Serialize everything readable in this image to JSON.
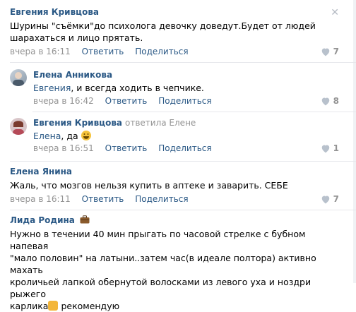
{
  "comments": [
    {
      "author": "Евгения Кривцова",
      "text_lines": [
        "Шурины \"съёмки\"до психолога девочку доведут.Будет от людей",
        "шарахаться и лицо прятать."
      ],
      "time": "вчера в 16:11",
      "reply": "Ответить",
      "share": "Поделиться",
      "likes": "7"
    },
    {
      "author": "Елена Анникова",
      "mention": "Евгения",
      "text": ", и всегда ходить в чепчике.",
      "time": "вчера в 16:42",
      "reply": "Ответить",
      "share": "Поделиться",
      "likes": "8"
    },
    {
      "author": "Евгения Кривцова",
      "replied_to": "ответила Елене",
      "mention": "Елена",
      "text": ", да",
      "emoji": "grinning-face",
      "time": "вчера в 16:51",
      "reply": "Ответить",
      "share": "Поделиться",
      "likes": "1"
    },
    {
      "author": "Елена Янина",
      "text": "Жаль, что мозгов нельзя купить в аптеке и заварить. СЕБЕ",
      "time": "вчера в 16:11",
      "reply": "Ответить",
      "share": "Поделиться",
      "likes": "7"
    },
    {
      "author": "Лида Родина",
      "badge": "briefcase-icon",
      "text_lines": [
        "Нужно в течении 40 мин прыгать по часовой стрелке с бубном напевая",
        "\"мало половин\" на латыни..затем час(в идеале полтора) активно махать",
        "кроличьей лапкой обернутой волосками из левого уха и ноздри рыжего",
        "карлика",
        " рекомендую"
      ],
      "emoji": "ok-hand"
    }
  ],
  "colors": {
    "link": "#2a5885",
    "muted": "#939393",
    "divider": "#e7e8ec"
  }
}
